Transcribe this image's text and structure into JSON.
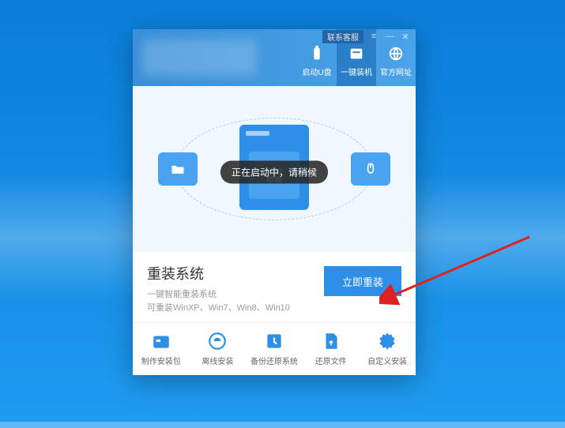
{
  "window_controls": {
    "contact": "联系客服"
  },
  "tabs": [
    {
      "label": "启动U盘"
    },
    {
      "label": "一键装机"
    },
    {
      "label": "官方网址"
    }
  ],
  "toast": "正在启动中，请稍候",
  "main": {
    "title": "重装系统",
    "subtitle1": "一键智能重装系统",
    "subtitle2": "可重装WinXP、Win7、Win8、Win10",
    "button": "立即重装"
  },
  "tools": [
    {
      "label": "制作安装包"
    },
    {
      "label": "离线安装"
    },
    {
      "label": "备份还原系统"
    },
    {
      "label": "还原文件"
    },
    {
      "label": "自定义安装"
    }
  ],
  "colors": {
    "primary": "#2d8fe8",
    "bg": "#f0f7fe"
  }
}
